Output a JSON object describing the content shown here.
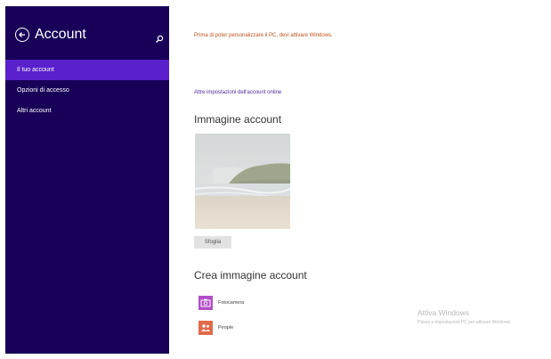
{
  "sidebar": {
    "title": "Account",
    "icons": {
      "back": "back-arrow-icon",
      "search": "search-icon"
    },
    "items": [
      {
        "label": "Il tuo account",
        "active": true
      },
      {
        "label": "Opzioni di accesso",
        "active": false
      },
      {
        "label": "Altri account",
        "active": false
      }
    ],
    "colors": {
      "background": "#180058",
      "active": "#5a20cc"
    }
  },
  "main": {
    "activation_message": "Prima di poter personalizzare il PC, devi attivare Windows.",
    "online_settings_link": "Altre impostazioni dell'account online",
    "account_picture": {
      "heading": "Immagine account",
      "browse_button": "Sfoglia"
    },
    "create_picture": {
      "heading": "Crea immagine account",
      "apps": [
        {
          "label": "Fotocamera",
          "icon": "camera-icon",
          "color": "#b24ec8"
        },
        {
          "label": "People",
          "icon": "people-icon",
          "color": "#e26a4a"
        }
      ]
    }
  },
  "watermark": {
    "line1": "Attiva Windows",
    "line2": "Passa a Impostazioni PC per attivare Windows."
  }
}
